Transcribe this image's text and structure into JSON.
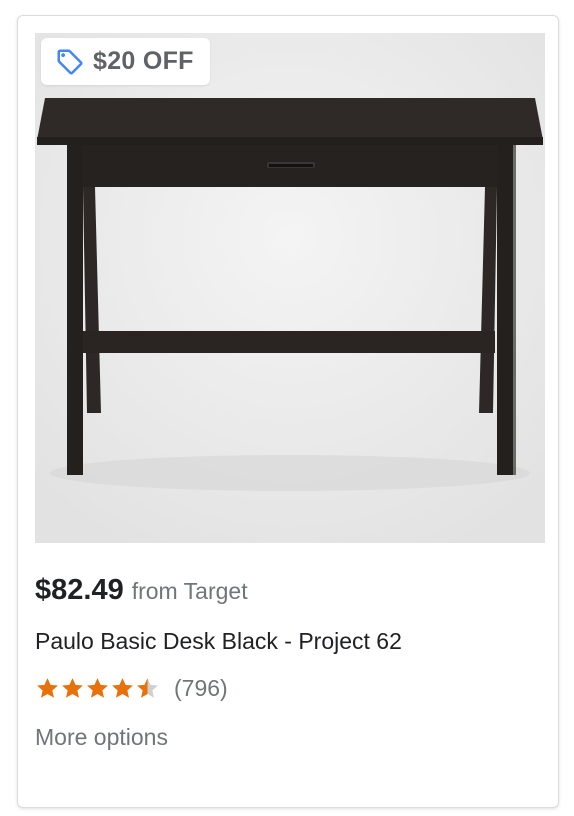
{
  "product": {
    "badge": {
      "text": "$20 OFF",
      "icon": "tag-icon"
    },
    "price": "$82.49",
    "merchant": "from Target",
    "title": "Paulo Basic Desk Black - Project 62",
    "rating": {
      "value": 4.5,
      "max": 5,
      "review_count": "(796)"
    },
    "more_options": "More options"
  },
  "colors": {
    "star": "#e8710a",
    "star_empty": "#d0d0d0",
    "tag_icon": "#4285f4",
    "desk": "#2a2522",
    "image_bg": "#e9e9e9"
  }
}
